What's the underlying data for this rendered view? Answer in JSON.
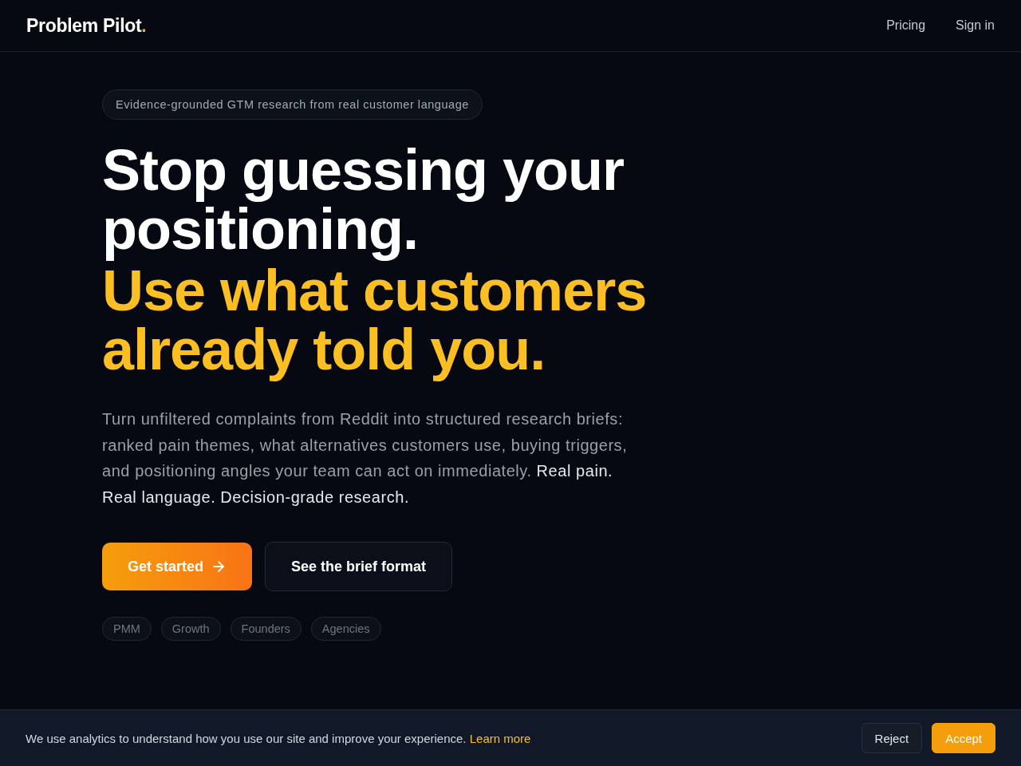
{
  "header": {
    "logo": {
      "name": "Problem Pilot",
      "mark": "."
    },
    "nav": [
      {
        "label": "Pricing"
      },
      {
        "label": "Sign in"
      }
    ]
  },
  "hero": {
    "badge": "Evidence-grounded GTM research from real customer language",
    "headline": "Stop guessing your positioning.",
    "headline_accent": "Use what customers already told you.",
    "description": "Turn unfiltered complaints from Reddit into structured research briefs: ranked pain themes, what alternatives customers use, buying triggers, and positioning angles your team can act on immediately. **Real pain. Real language. Decision-grade research.**",
    "buttons": [
      {
        "label": "Get started",
        "kind": "primary"
      },
      {
        "label": "See the brief format",
        "kind": "secondary"
      }
    ],
    "audiences": [
      "PMM",
      "Growth",
      "Founders",
      "Agencies"
    ]
  },
  "cookie_banner": {
    "text": "We use analytics to understand how you use our site and improve your experience.",
    "link": "Learn more",
    "buttons": [
      {
        "label": "Reject",
        "kind": "secondary"
      },
      {
        "label": "Accept",
        "kind": "primary"
      }
    ]
  }
}
